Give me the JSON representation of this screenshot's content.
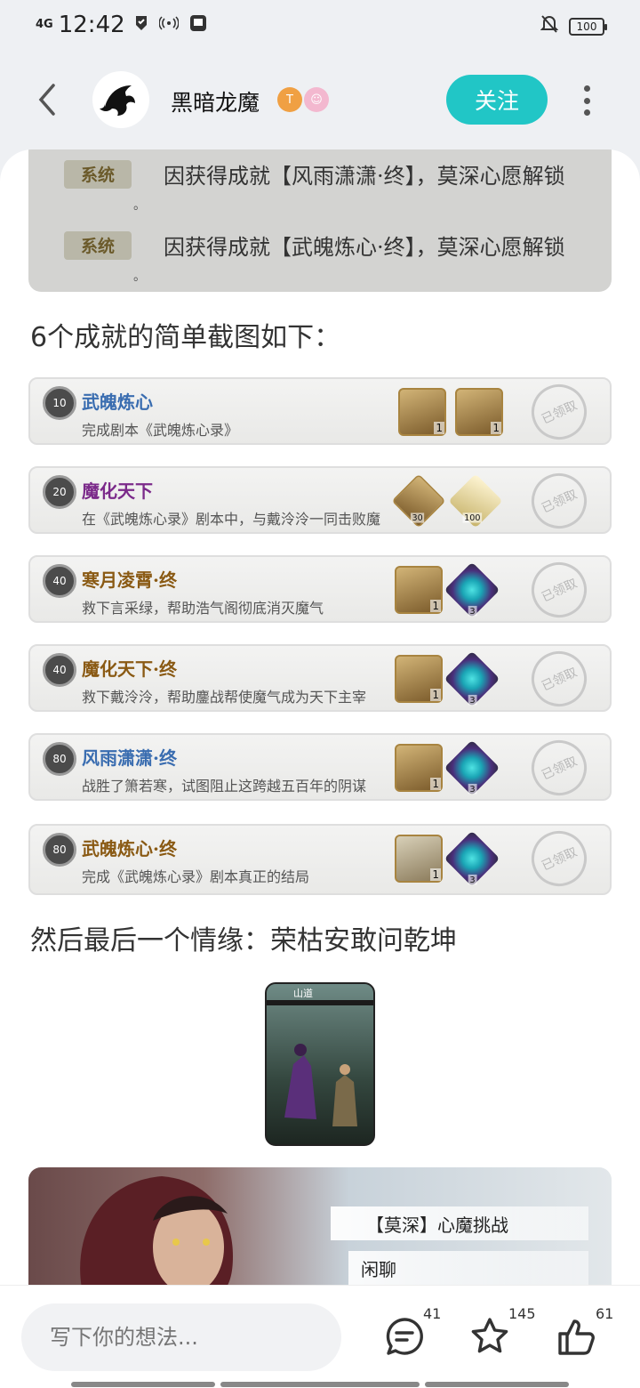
{
  "status_bar": {
    "network": "4G",
    "time": "12:42",
    "battery": "100"
  },
  "header": {
    "username": "黑暗龙魔",
    "badge_1": "T",
    "badge_2": "☺",
    "follow_label": "关注"
  },
  "system_box": {
    "tag": "系统",
    "line_1": "因获得成就【风雨潇潇·终】，莫深心愿解锁",
    "line_2": "因获得成就【武魄炼心·终】，莫深心愿解锁",
    "dot": "。"
  },
  "post": {
    "para_1": "6个成就的简单截图如下：",
    "para_2": "然后最后一个情缘：荣枯安敢问乾坤"
  },
  "achievements": [
    {
      "level": "10",
      "title": "武魄炼心",
      "title_color": "#3a6db0",
      "desc": "完成剧本《武魄炼心录》",
      "r1": "1",
      "r2": "1",
      "claimed": "已领取"
    },
    {
      "level": "20",
      "title": "魔化天下",
      "title_color": "#7b2a8a",
      "desc": "在《武魄炼心录》剧本中，与戴泠泠一同击败魔",
      "r1": "30",
      "r2": "100",
      "claimed": "已领取"
    },
    {
      "level": "40",
      "title": "寒月凌霄·终",
      "title_color": "#8a5a14",
      "desc": "救下言采绿，帮助浩气阁彻底消灭魔气",
      "r1": "1",
      "r2": "3",
      "claimed": "已领取"
    },
    {
      "level": "40",
      "title": "魔化天下·终",
      "title_color": "#8a5a14",
      "desc": "救下戴泠泠，帮助鏖战帮使魔气成为天下主宰",
      "r1": "1",
      "r2": "3",
      "claimed": "已领取"
    },
    {
      "level": "80",
      "title": "风雨潇潇·终",
      "title_color": "#3a6db0",
      "desc": "战胜了箫若寒，试图阻止这跨越五百年的阴谋",
      "r1": "1",
      "r2": "3",
      "claimed": "已领取"
    },
    {
      "level": "80",
      "title": "武魄炼心·终",
      "title_color": "#8a5a14",
      "desc": "完成《武魄炼心录》剧本真正的结局",
      "r1": "1",
      "r2": "3",
      "claimed": "已领取"
    }
  ],
  "thumbnail": {
    "location": "山道"
  },
  "banner": {
    "option_1": "【莫深】心魔挑战",
    "option_2": "闲聊"
  },
  "bottom_bar": {
    "comment_placeholder": "写下你的想法...",
    "comment_count": "41",
    "favorite_count": "145",
    "like_count": "61"
  },
  "colors": {
    "accent": "#21c6c6"
  }
}
